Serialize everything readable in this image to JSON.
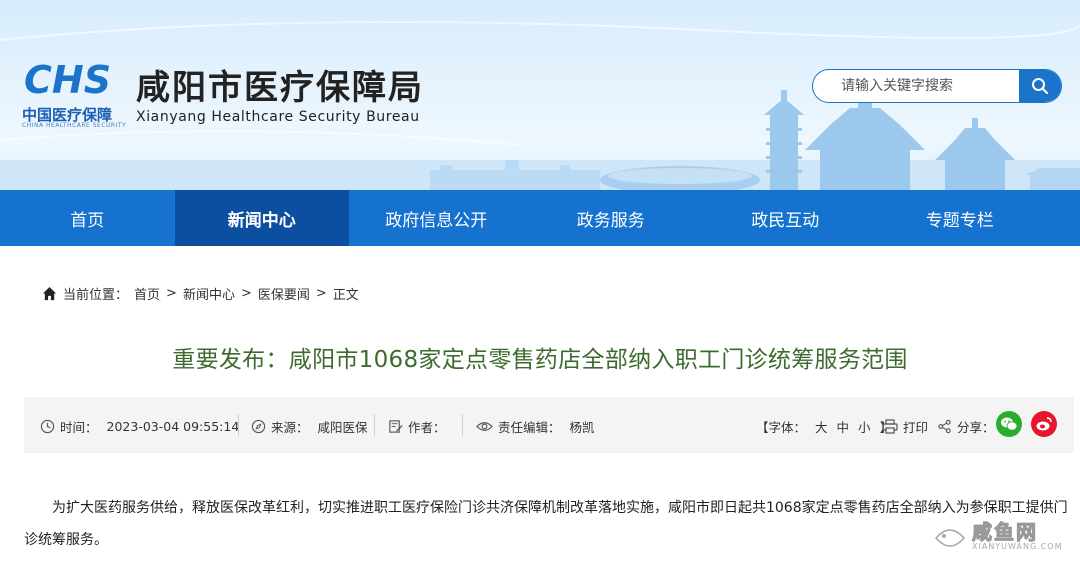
{
  "header": {
    "logo_mark": "CHS",
    "logo_cn": "中国医疗保障",
    "logo_en": "CHINA HEALTHCARE SECURITY",
    "title": "咸阳市医疗保障局",
    "subtitle": "Xianyang Healthcare Security Bureau"
  },
  "search": {
    "placeholder": "请输入关键字搜索",
    "icon": "search-icon"
  },
  "nav": {
    "items": [
      {
        "label": "首页"
      },
      {
        "label": "新闻中心"
      },
      {
        "label": "政府信息公开"
      },
      {
        "label": "政务服务"
      },
      {
        "label": "政民互动"
      },
      {
        "label": "专题专栏"
      }
    ],
    "active_index": 1
  },
  "breadcrumb": {
    "prefix": "当前位置：",
    "items": [
      "首页",
      "新闻中心",
      "医保要闻",
      "正文"
    ],
    "separator": ">"
  },
  "article": {
    "title": "重要发布：咸阳市1068家定点零售药店全部纳入职工门诊统筹服务范围",
    "meta": {
      "time_label": "时间：",
      "time_value": "2023-03-04 09:55:14",
      "source_label": "来源：",
      "source_value": "咸阳医保",
      "author_label": "作者：",
      "author_value": "",
      "editor_label": "责任编辑：",
      "editor_value": "杨凯",
      "font_size_label": "【字体：",
      "font_large": "大",
      "font_medium": "中",
      "font_small": "小",
      "font_size_end": "】",
      "print_label": "打印",
      "share_label": "分享："
    },
    "body": "为扩大医药服务供给，释放医保改革红利，切实推进职工医疗保险门诊共济保障机制改革落地实施，咸阳市即日起共1068家定点零售药店全部纳入为参保职工提供门诊统筹服务。"
  },
  "watermark": {
    "text": "咸鱼网",
    "sub": "XIANYUWANG.COM"
  },
  "colors": {
    "nav_bg": "#1573cf",
    "nav_active": "#0c4fa0",
    "title_green": "#3d6b2e",
    "wechat": "#2aae2a",
    "weibo": "#e6162d"
  }
}
